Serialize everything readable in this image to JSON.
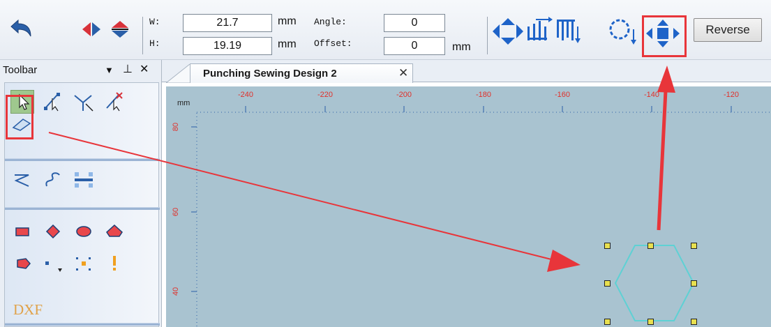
{
  "toolbar": {
    "w_label": "W:",
    "h_label": "H:",
    "width_value": "21.7",
    "height_value": "19.19",
    "unit_mm": "mm",
    "angle_label": "Angle:",
    "angle_value": "0",
    "offset_label": "Offset:",
    "offset_value": "0",
    "reverse_label": "Reverse"
  },
  "left_panel": {
    "title": "Toolbar",
    "pin_glyph": "▼",
    "dock_glyph": "⊥",
    "close_glyph": "✕",
    "dxf_label": "DXF"
  },
  "document_tab": {
    "label": "Punching Sewing Design 2",
    "close_glyph": "✕"
  },
  "canvas": {
    "ruler_unit": "mm",
    "x_ticks": [
      "-240",
      "-220",
      "-200",
      "-180",
      "-160",
      "-140",
      "-120"
    ],
    "y_ticks": [
      "80",
      "60",
      "40"
    ],
    "shape_color": "#5ed1d4",
    "background_color": "#a9c3d0",
    "handle_color": "#e8e050",
    "annotation_color": "#e8353a"
  },
  "icons": [
    "undo-icon",
    "flip-horizontal-icon",
    "flip-vertical-icon",
    "move-arrows-icon",
    "align-top-icon",
    "align-bottom-icon",
    "rotate-icon",
    "center-icon",
    "select-arrow-icon"
  ]
}
